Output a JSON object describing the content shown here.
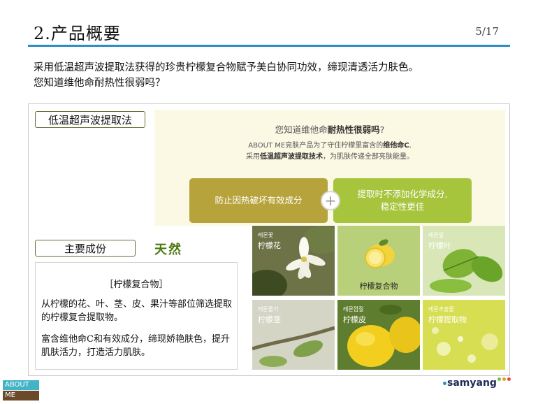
{
  "header": {
    "title": "2.产品概要",
    "page": "5/17"
  },
  "intro": {
    "line1": "采用低温超声波提取法获得的珍贵柠檬复合物赋予美白协同功效，缔现清透活力肤色。",
    "line2": "您知道维他命耐热性很弱吗？"
  },
  "colors": {
    "accent": "#2c8fc4",
    "olive": "#b7a33c",
    "lime": "#a7c43d",
    "natural": "#4d7a12"
  },
  "section1": {
    "tag": "低温超声波提取法",
    "question_pre": "您知道维他命",
    "question_bold": "耐热性很弱吗",
    "question_post": "?",
    "desc1_pre": "ABOUT ME亮肤产品为了守住柠檬里富含的",
    "desc1_bold": "维他命C",
    "desc1_post": ",",
    "desc2_pre": "采用",
    "desc2_bold": "低温超声波提取技术",
    "desc2_post": "，为肌肤传递全部亮肤能量。",
    "pill1": "防止因热破坏有效成分",
    "pill2_line1": "提取时不添加化学成分,",
    "pill2_line2": "稳定性更佳",
    "plus": "+"
  },
  "section2": {
    "tag": "主要成份",
    "natural": "天然",
    "box_title": "［柠檬复合物］",
    "p1": "从柠檬的花、叶、茎、皮、果汁等部位筛选提取的柠檬复合提取物。",
    "p2": "富含维他命C和有效成分，缔现娇艳肤色，提升肌肤活力，打造活力肌肤。"
  },
  "grid": [
    {
      "korean": "레몬꽃",
      "label": "柠檬花"
    },
    {
      "korean": "",
      "label": "柠檬复合物"
    },
    {
      "korean": "레몬잎",
      "label": "柠檬叶"
    },
    {
      "korean": "레몬줄기",
      "label": "柠檬茎"
    },
    {
      "korean": "레몬껍질",
      "label": "柠檬皮"
    },
    {
      "korean": "레몬추출물",
      "label": "柠檬提取物"
    }
  ],
  "footer": {
    "logo_top": "ABOUT",
    "logo_bottom": "ME",
    "brand": "samyang"
  }
}
